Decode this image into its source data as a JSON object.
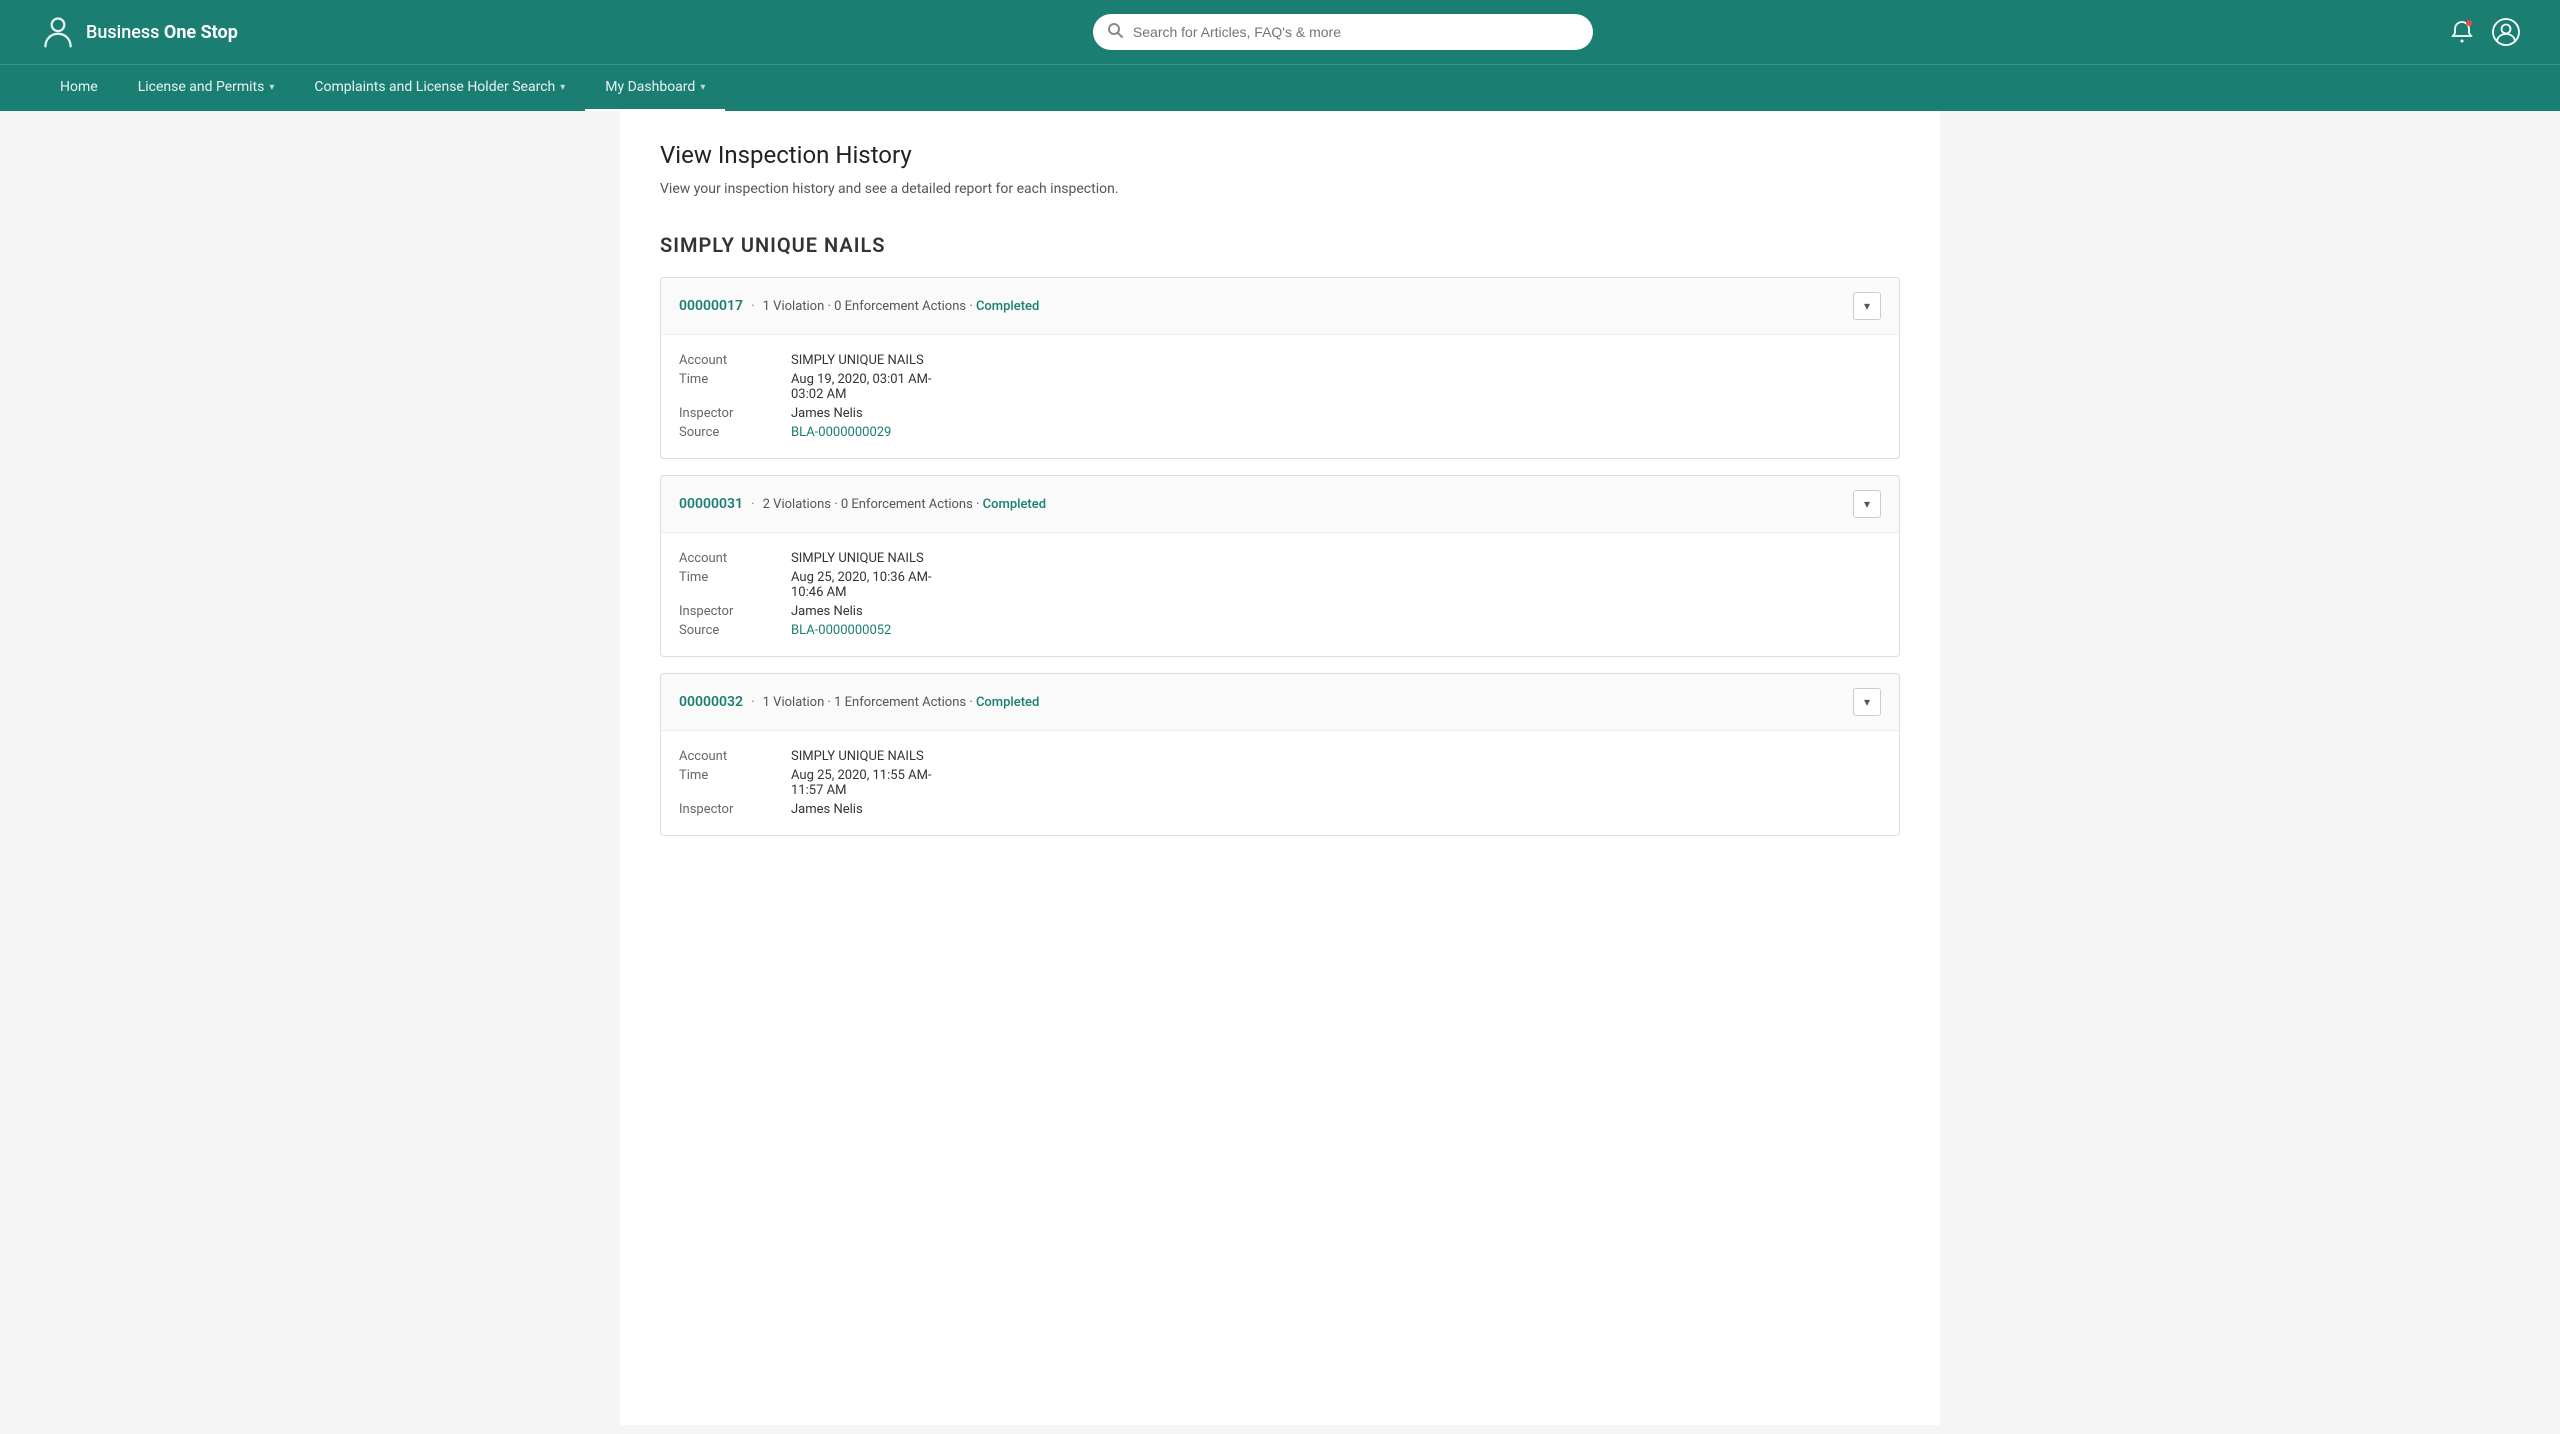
{
  "app": {
    "title": "Business One Stop"
  },
  "header": {
    "logo_text_regular": "Business",
    "logo_text_bold": "One Stop",
    "search_placeholder": "Search for Articles, FAQ's & more"
  },
  "nav": {
    "items": [
      {
        "id": "home",
        "label": "Home",
        "has_dropdown": false
      },
      {
        "id": "license-permits",
        "label": "License and Permits",
        "has_dropdown": true
      },
      {
        "id": "complaints",
        "label": "Complaints and License Holder Search",
        "has_dropdown": true
      },
      {
        "id": "dashboard",
        "label": "My Dashboard",
        "has_dropdown": true,
        "active": true
      }
    ]
  },
  "page": {
    "title": "View Inspection History",
    "subtitle": "View your inspection history and see a detailed report for each inspection."
  },
  "business": {
    "name": "SIMPLY UNIQUE NAILS"
  },
  "inspections": [
    {
      "id": "00000017",
      "violations": "1 Violation",
      "enforcement": "0 Enforcement Actions",
      "status": "Completed",
      "account": "SIMPLY UNIQUE NAILS",
      "time_line1": "Aug 19, 2020, 03:01 AM-",
      "time_line2": "03:02 AM",
      "inspector": "James Nelis",
      "source": "BLA-0000000029"
    },
    {
      "id": "00000031",
      "violations": "2 Violations",
      "enforcement": "0 Enforcement Actions",
      "status": "Completed",
      "account": "SIMPLY UNIQUE NAILS",
      "time_line1": "Aug 25, 2020, 10:36 AM-",
      "time_line2": "10:46 AM",
      "inspector": "James Nelis",
      "source": "BLA-0000000052"
    },
    {
      "id": "00000032",
      "violations": "1 Violation",
      "enforcement": "1 Enforcement Actions",
      "status": "Completed",
      "account": "SIMPLY UNIQUE NAILS",
      "time_line1": "Aug 25, 2020, 11:55 AM-",
      "time_line2": "11:57 AM",
      "inspector": "James Nelis",
      "source": ""
    }
  ],
  "labels": {
    "account": "Account",
    "time": "Time",
    "inspector": "Inspector",
    "source": "Source",
    "separator_dot": "·",
    "dropdown_arrow": "▾"
  }
}
